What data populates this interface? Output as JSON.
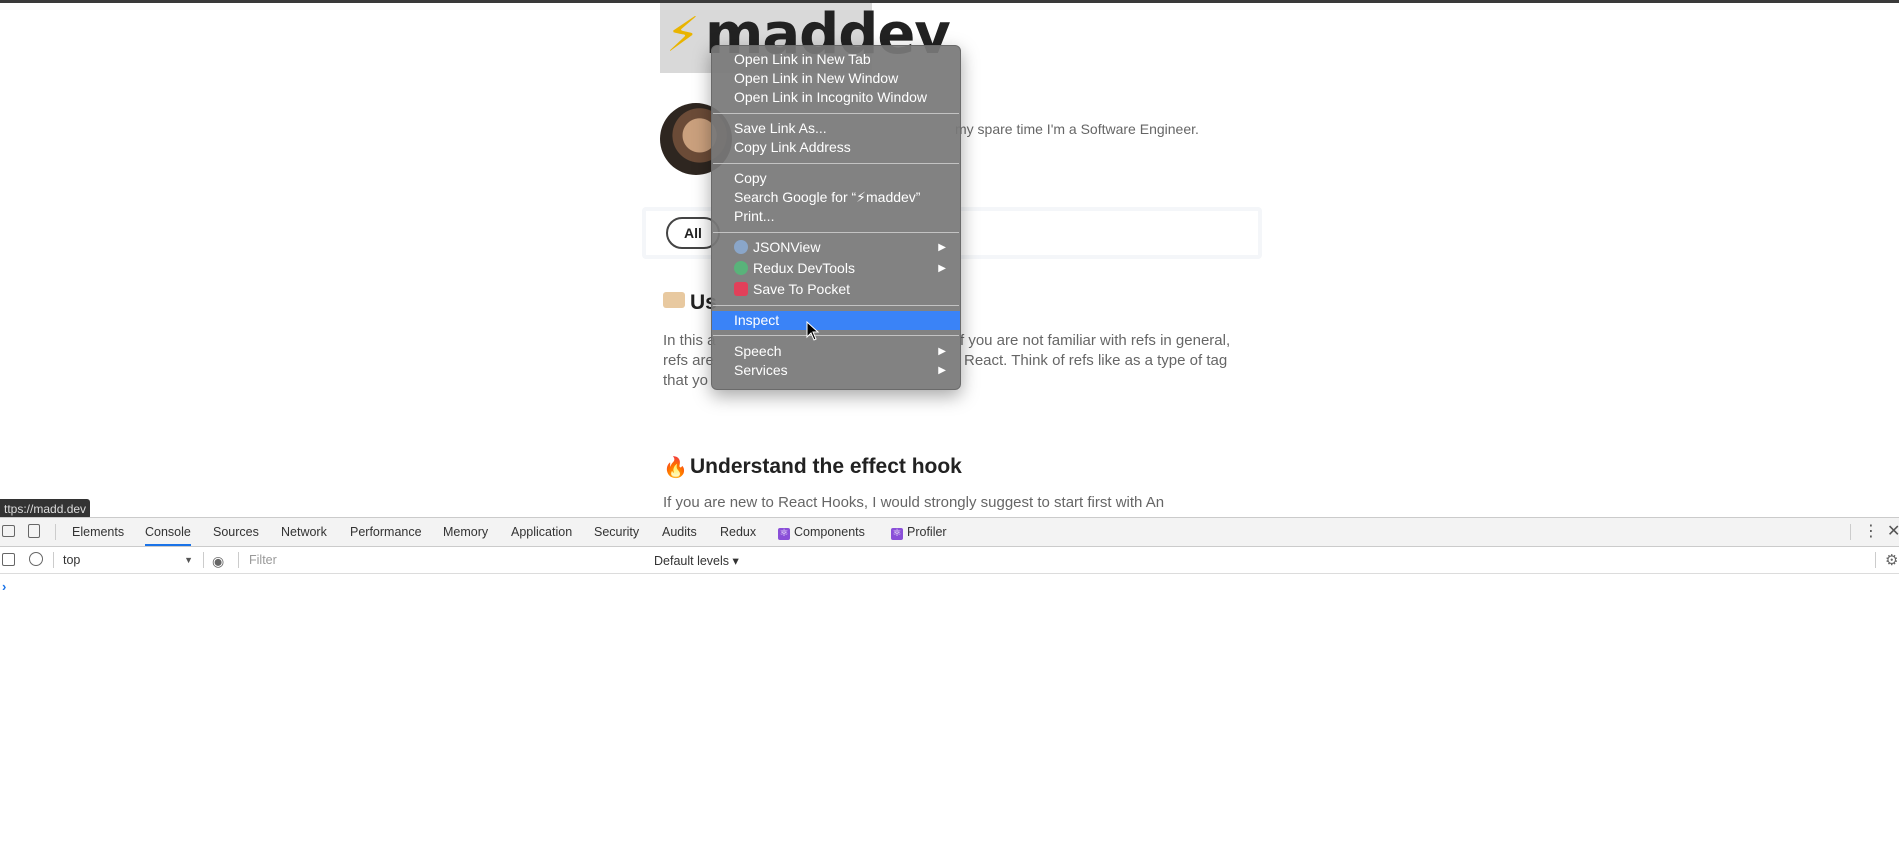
{
  "page": {
    "logo_bolt": "⚡",
    "logo_text": "maddev",
    "bio_fragment": "my spare time I'm a Software Engineer.",
    "filter_all_label": "All",
    "article1": {
      "title_fragment": "Us",
      "lines": [
        "In this a",
        "f you are not familiar with refs in general,",
        "refs are",
        "React. Think of refs like as a type of tag",
        "that yo"
      ]
    },
    "article2": {
      "icon": "🔥",
      "title": "Understand the effect hook",
      "line1": "If you are new to React Hooks, I would strongly suggest to start first with An"
    },
    "status_url": "ttps://madd.dev"
  },
  "context_menu": {
    "groups": [
      [
        "Open Link in New Tab",
        "Open Link in New Window",
        "Open Link in Incognito Window"
      ],
      [
        "Save Link As...",
        "Copy Link Address"
      ],
      [
        "Copy",
        "Search Google for “⚡maddev”",
        "Print..."
      ]
    ],
    "extensions": [
      {
        "label": "JSONView",
        "icon": "jsonview-icon",
        "color": "#8aa6c9",
        "submenu": true
      },
      {
        "label": "Redux DevTools",
        "icon": "redux-icon",
        "color": "#59b37a",
        "submenu": true
      },
      {
        "label": "Save To Pocket",
        "icon": "pocket-icon",
        "color": "#e2405a",
        "submenu": false
      }
    ],
    "highlighted": "Inspect",
    "tail": [
      {
        "label": "Speech",
        "submenu": true
      },
      {
        "label": "Services",
        "submenu": true
      }
    ],
    "submenu_arrow": "▶"
  },
  "devtools": {
    "tabs": [
      "Elements",
      "Console",
      "Sources",
      "Network",
      "Performance",
      "Memory",
      "Application",
      "Security",
      "Audits",
      "Redux",
      "Components",
      "Profiler"
    ],
    "active_tab": "Console",
    "context_value": "top",
    "filter_placeholder": "Filter",
    "levels_label": "Default levels ▾",
    "prompt": "›",
    "accent": "#1a73e8"
  }
}
